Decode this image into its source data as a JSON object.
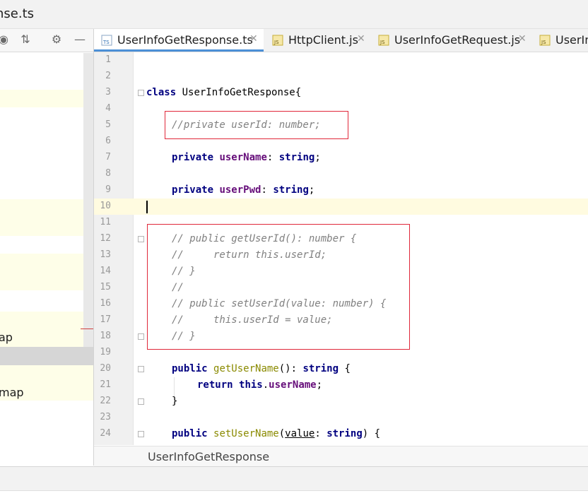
{
  "window": {
    "title": "nse.ts"
  },
  "project_panel": {
    "tree_items": [
      {
        "label": "ap"
      },
      {
        "label": "map"
      }
    ]
  },
  "tabs": [
    {
      "label": "UserInfoGetResponse.ts",
      "icon": "typescript-file-icon",
      "icon_text": "TS",
      "active": true
    },
    {
      "label": "HttpClient.js",
      "icon": "javascript-file-icon",
      "icon_text": "JS",
      "active": false
    },
    {
      "label": "UserInfoGetRequest.js",
      "icon": "javascript-file-icon",
      "icon_text": "JS",
      "active": false
    },
    {
      "label": "UserIn",
      "icon": "javascript-file-icon",
      "icon_text": "JS",
      "active": false
    }
  ],
  "editor": {
    "line_numbers": [
      "1",
      "2",
      "3",
      "4",
      "5",
      "6",
      "7",
      "8",
      "9",
      "10",
      "11",
      "12",
      "13",
      "14",
      "15",
      "16",
      "17",
      "18",
      "19",
      "20",
      "21",
      "22",
      "23",
      "24"
    ],
    "current_line": "10",
    "code": {
      "l3_kw": "class",
      "l3_rest": " UserInfoGetResponse{",
      "l5": "//private userId: number;",
      "l7_kw": "private",
      "l7_field": "userName",
      "l7_colon": ": ",
      "l7_type": "string",
      "l7_end": ";",
      "l9_kw": "private",
      "l9_field": "userPwd",
      "l9_colon": ": ",
      "l9_type": "string",
      "l9_end": ";",
      "l12": "// public getUserId(): number {",
      "l13": "//     return this.userId;",
      "l14": "// }",
      "l15": "//",
      "l16": "// public setUserId(value: number) {",
      "l17": "//     this.userId = value;",
      "l18": "// }",
      "l20_kw": "public",
      "l20_method": "getUserName",
      "l20_paren": "(): ",
      "l20_type": "string",
      "l20_end": " {",
      "l21_kw": "return",
      "l21_this": "this",
      "l21_dot": ".",
      "l21_field": "userName",
      "l21_end": ";",
      "l22": "}",
      "l24_kw": "public",
      "l24_method": "setUserName",
      "l24_open": "(",
      "l24_param": "value",
      "l24_colon": ": ",
      "l24_type": "string",
      "l24_end": ") {"
    }
  },
  "breadcrumb": {
    "text": "UserInfoGetResponse"
  },
  "colors": {
    "keyword": "#000080",
    "field": "#660e7a",
    "comment": "#808080",
    "method": "#8a8a00",
    "highlight_box": "#e0283a",
    "active_tab_underline": "#4b8fd6"
  }
}
